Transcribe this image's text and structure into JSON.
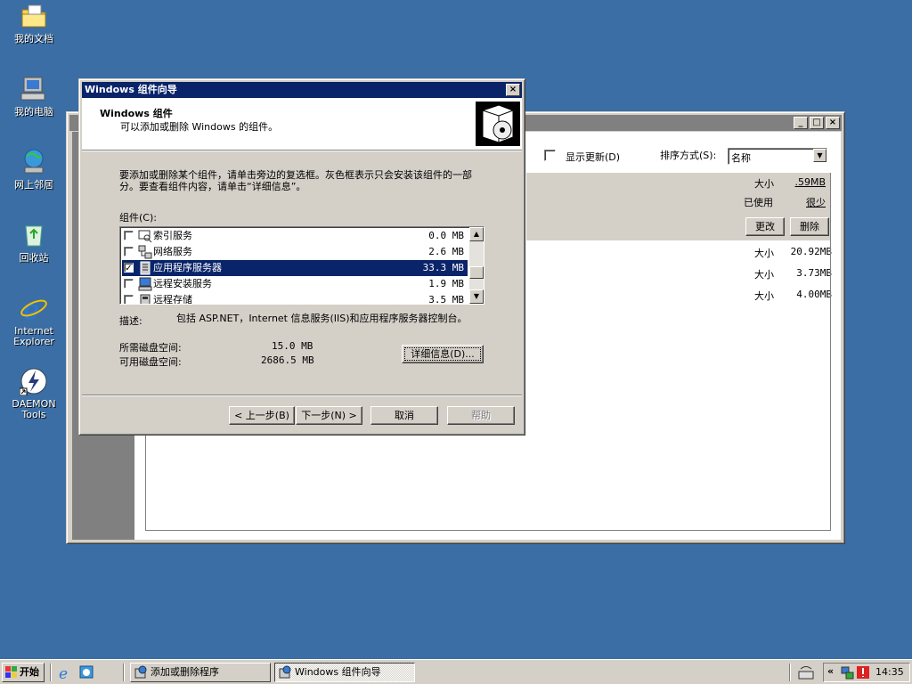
{
  "desktop": {
    "icons": [
      {
        "label": "我的文档"
      },
      {
        "label": "我的电脑"
      },
      {
        "label": "网上邻居"
      },
      {
        "label": "回收站"
      },
      {
        "label": "Internet Explorer"
      },
      {
        "label": "DAEMON Tools"
      }
    ]
  },
  "bg_window": {
    "show_updates_label": "显示更新(D)",
    "sort_label": "排序方式(S):",
    "sort_value": "名称",
    "size_label": "大小",
    "size_value": ".59MB",
    "used_label": "已使用",
    "used_value": "很少",
    "change_button": "更改",
    "remove_button": "删除",
    "rows": [
      {
        "label": "大小",
        "value": "20.92MB"
      },
      {
        "label": "大小",
        "value": "3.73MB"
      },
      {
        "label": "大小",
        "value": "4.00MB"
      }
    ]
  },
  "wizard": {
    "title": "Windows 组件向导",
    "header_title": "Windows 组件",
    "header_subtitle": "可以添加或删除 Windows 的组件。",
    "instructions": "要添加或删除某个组件，请单击旁边的复选框。灰色框表示只会安装该组件的一部分。要查看组件内容，请单击“详细信息”。",
    "components_label": "组件(C):",
    "components": [
      {
        "name": "索引服务",
        "size": "0.0 MB",
        "checked": false,
        "selected": false
      },
      {
        "name": "网络服务",
        "size": "2.6 MB",
        "checked": false,
        "selected": false
      },
      {
        "name": "应用程序服务器",
        "size": "33.3 MB",
        "checked": true,
        "selected": true
      },
      {
        "name": "远程安装服务",
        "size": "1.9 MB",
        "checked": false,
        "selected": false
      },
      {
        "name": "远程存储",
        "size": "3.5 MB",
        "checked": false,
        "selected": false
      }
    ],
    "description_label": "描述:",
    "description_text": "包括 ASP.NET，Internet 信息服务(IIS)和应用程序服务器控制台。",
    "required_space_label": "所需磁盘空间:",
    "required_space_value": "15.0 MB",
    "available_space_label": "可用磁盘空间:",
    "available_space_value": "2686.5 MB",
    "details_button": "详细信息(D)...",
    "back_button": "< 上一步(B)",
    "next_button": "下一步(N) >",
    "cancel_button": "取消",
    "help_button": "帮助"
  },
  "taskbar": {
    "start_label": "开始",
    "tasks": [
      {
        "label": "添加或删除程序"
      },
      {
        "label": "Windows 组件向导"
      }
    ],
    "tray_arrows": "«",
    "clock": "14:35"
  }
}
